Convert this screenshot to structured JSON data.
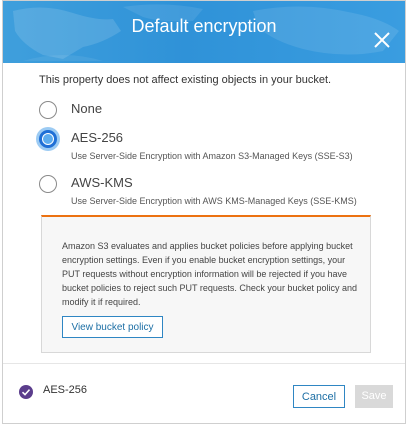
{
  "dialog": {
    "title": "Default encryption",
    "info": "This property does not affect existing objects in your bucket."
  },
  "options": [
    {
      "label": "None",
      "description": "",
      "selected": false
    },
    {
      "label": "AES-256",
      "description": "Use Server-Side Encryption with Amazon S3-Managed Keys (SSE-S3)",
      "selected": true
    },
    {
      "label": "AWS-KMS",
      "description": "Use Server-Side Encryption with AWS KMS-Managed Keys (SSE-KMS)",
      "selected": false
    }
  ],
  "warning": {
    "text": "Amazon S3 evaluates and applies bucket policies before applying bucket encryption settings. Even if you enable bucket encryption settings, your PUT requests without encryption information will be rejected if you have bucket policies to reject such PUT requests. Check your bucket policy and modify it if required.",
    "button_label": "View bucket policy"
  },
  "footer": {
    "selected_label": "AES-256",
    "cancel_label": "Cancel",
    "save_label": "Save"
  },
  "colors": {
    "header_blue": "#3a9de0",
    "selected_radio": "#1f6fd6",
    "warning_border": "#ec7211",
    "footer_check": "#5b3d8c"
  }
}
